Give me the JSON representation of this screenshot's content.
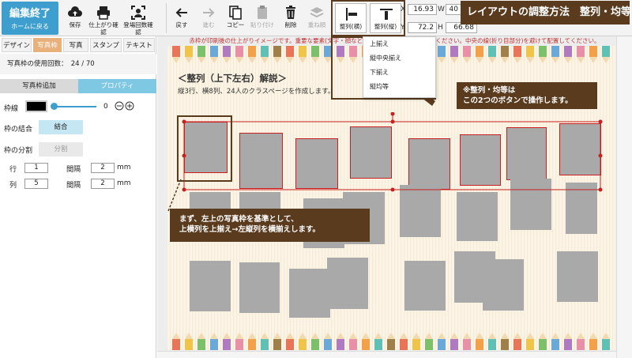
{
  "toolbar": {
    "finish_label": "編集終了",
    "home_label": "ホームに戻る",
    "save_label": "保存",
    "print_check_label": "仕上がり確認",
    "appearance_check_label": "登場回数確認",
    "back_label": "戻す",
    "forward_label": "進む",
    "copy_label": "コピー",
    "paste_label": "貼り付け",
    "delete_label": "削除",
    "layer_label": "重ね順",
    "align_h_label": "整列(横)",
    "align_v_label": "整列(縦)",
    "title_banner": "レイアウトの調整方法　整列・均等"
  },
  "coords": {
    "x_label": "X",
    "x_value": "16.93",
    "y_label": "Y",
    "y_value": "72.2",
    "w_label": "W",
    "w_value": "40",
    "h_label": "H",
    "h_value": "66.68"
  },
  "left_panel": {
    "tabs": [
      "デザイン",
      "写真枠",
      "写真",
      "スタンプ",
      "テキスト"
    ],
    "active_tab": "写真枠",
    "photo_count": "写真枠の使用回数：　24 / 70",
    "subtab_add": "写真枠追加",
    "subtab_props": "プロパティ",
    "border_label": "枠線",
    "border_value": "0",
    "merge_label": "枠の結合",
    "merge_button": "結合",
    "split_label": "枠の分割",
    "split_button": "分割",
    "row_label": "行",
    "row_value": "1",
    "col_label": "列",
    "col_value": "5",
    "gap_label": "間隔",
    "gap_row_value": "2",
    "gap_col_value": "2",
    "unit": "mm"
  },
  "canvas": {
    "notice": "赤枠が印刷後の仕上がりイメージです。重要な要素(文字・顔など)は、赤枠の内側に配置してください。中央の線(折り目部分)を避けて配置してください。",
    "explain_title": "＜整列（上下左右）解説＞",
    "explain_desc": "縦3行、横8列、24人のクラスページを作成します。",
    "callout_right": "※整列・均等は\nこの2つのボタンで操作します。",
    "callout_left": "まず、左上の写真枠を基準として、\n上横列を上揃え→左縦列を横揃えします。"
  },
  "dropdown": {
    "items": [
      "上揃え",
      "縦中央揃え",
      "下揃え",
      "縦均等"
    ]
  },
  "colors": {
    "accent_blue": "#3e9fcf",
    "tab_orange": "#e8b07a",
    "callout_brown": "#5a3b1e",
    "selection_red": "#c82020",
    "pencil_colors": [
      "#e8745a",
      "#f0c44a",
      "#7dc06b",
      "#6aa8d8",
      "#b07ac0",
      "#e890a8",
      "#f3a04a",
      "#5fc0b5",
      "#a0804a"
    ]
  }
}
